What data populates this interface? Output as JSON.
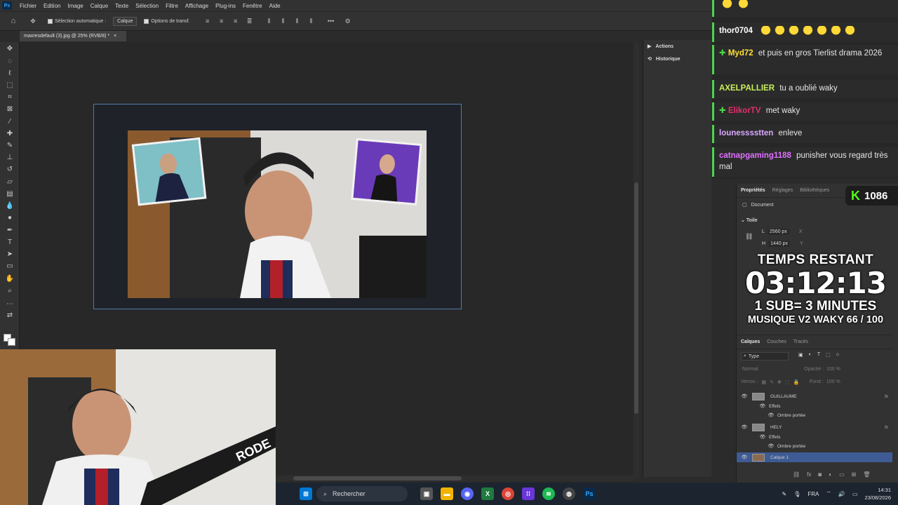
{
  "menu": {
    "app_logo": "Ps",
    "items": [
      "Fichier",
      "Edition",
      "Image",
      "Calque",
      "Texte",
      "Sélection",
      "Filtre",
      "Affichage",
      "Plug-ins",
      "Fenêtre",
      "Aide"
    ]
  },
  "options": {
    "auto_select_label": "Sélection automatique :",
    "auto_select_target": "Calque",
    "transform_label": "Options de transf."
  },
  "document": {
    "tab_title": "maxresdefault (3).jpg @ 25% (RVB/8) *",
    "close_glyph": "×"
  },
  "panel_mini": {
    "actions": "Actions",
    "history": "Historique"
  },
  "chat": {
    "messages": [
      {
        "user": "thor0704",
        "user_color": "#ffffff",
        "text": ""
      },
      {
        "user": "Myd72",
        "user_color": "#ffe033",
        "text": "et puis en gros Tierlist drama 2026"
      },
      {
        "user": "AXELPALLIER",
        "user_color": "#c8f05a",
        "text": "tu a oublié waky"
      },
      {
        "user": "ElikorTV",
        "user_color": "#e0306a",
        "text": "met waky"
      },
      {
        "user": "lounesssstten",
        "user_color": "#d9a8ff",
        "text": "enleve"
      },
      {
        "user": "catnapgaming1188",
        "user_color": "#e070ff",
        "text": "punisher vous regard très mal"
      }
    ],
    "emote_count": 7
  },
  "kick": {
    "logo": "K",
    "count": "1086"
  },
  "properties": {
    "tabs": [
      "Propriétés",
      "Réglages",
      "Bibliothèques"
    ],
    "doc_label": "Document",
    "canvas_section": "Toile",
    "width_value": "2560 px",
    "height_value": "1440 px",
    "x_label": "X",
    "y_label": "Y",
    "w_label": "L",
    "h_label": "H"
  },
  "overlay": {
    "time_label": "TEMPS RESTANT",
    "time_value": "03:12:13",
    "sub_rule": "1 SUB= 3 MINUTES",
    "music": "MUSIQUE V2 WAKY 66 / 100"
  },
  "layers": {
    "tabs": [
      "Calques",
      "Couches",
      "Tracés"
    ],
    "filter_type": "Type",
    "blend_mode": "Normal",
    "opacity_label": "Opacité :",
    "opacity_value": "100 %",
    "lock_label": "Verrou :",
    "fill_label": "Fond :",
    "fill_value": "100 %",
    "items": [
      {
        "name": "GUILLAUME",
        "kind": "layer",
        "fx": "fx"
      },
      {
        "name": "Effets",
        "kind": "effects"
      },
      {
        "name": "Ombre portée",
        "kind": "effect"
      },
      {
        "name": "HELY",
        "kind": "layer",
        "fx": "fx"
      },
      {
        "name": "Effets",
        "kind": "effects"
      },
      {
        "name": "Ombre portée",
        "kind": "effect"
      },
      {
        "name": "Calque 1",
        "kind": "layer",
        "selected": true
      }
    ]
  },
  "taskbar": {
    "search_placeholder": "Rechercher",
    "language": "FRA",
    "time": "14:31",
    "date": "23/08/2026",
    "ps_label": "Ps"
  },
  "colors": {
    "accent": "#31a8ff",
    "selection": "#3e5b94",
    "chat_bar": "#4bd64b",
    "kick_green": "#53fc18"
  }
}
